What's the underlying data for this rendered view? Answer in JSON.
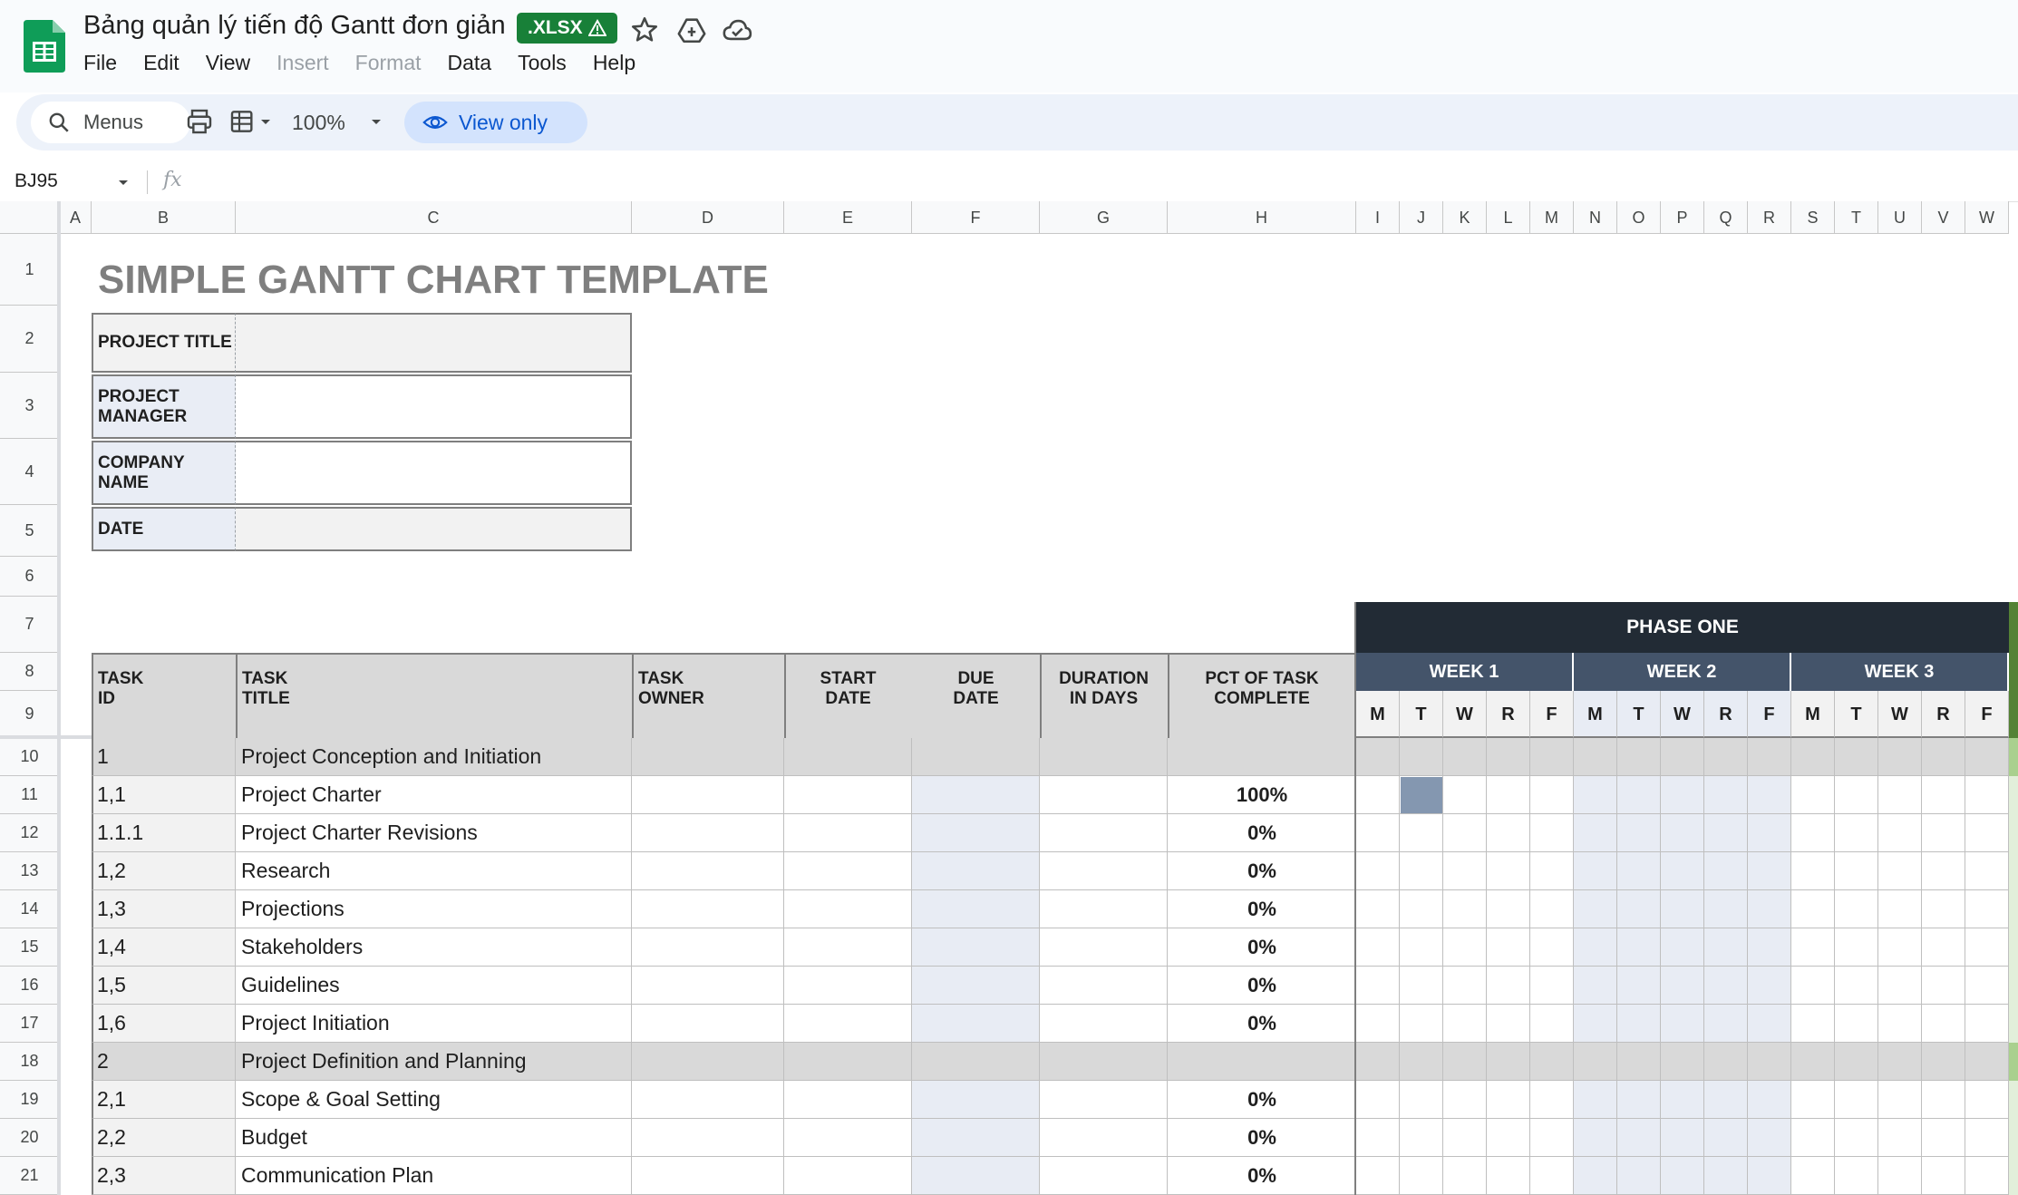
{
  "app": {
    "doc_title": "Bảng quản lý tiến độ Gantt đơn giản",
    "file_badge": ".XLSX",
    "brand_color": "#188038",
    "menu": [
      "File",
      "Edit",
      "View",
      "Insert",
      "Format",
      "Data",
      "Tools",
      "Help"
    ],
    "menu_disabled": [
      "Insert",
      "Format"
    ]
  },
  "toolbar": {
    "search_label": "Menus",
    "zoom": "100%",
    "view_only_label": "View only"
  },
  "formula_bar": {
    "cell_ref": "BJ95",
    "fx_label": "fx"
  },
  "columns": [
    "A",
    "B",
    "C",
    "D",
    "E",
    "F",
    "G",
    "H",
    "I",
    "J",
    "K",
    "L",
    "M",
    "N",
    "O",
    "P",
    "Q",
    "R",
    "S",
    "T",
    "U",
    "V",
    "W"
  ],
  "rows": [
    "1",
    "2",
    "3",
    "4",
    "5",
    "6",
    "7",
    "8",
    "9",
    "10",
    "11",
    "12",
    "13",
    "14",
    "15",
    "16",
    "17",
    "18",
    "19",
    "20",
    "21"
  ],
  "sheet": {
    "title": "SIMPLE GANTT CHART TEMPLATE",
    "info_labels": {
      "project_title": "PROJECT TITLE",
      "project_manager_1": "PROJECT",
      "project_manager_2": "MANAGER",
      "company_name_1": "COMPANY",
      "company_name_2": "NAME",
      "date": "DATE"
    },
    "headers": {
      "task_id_1": "TASK",
      "task_id_2": "ID",
      "task_title_1": "TASK",
      "task_title_2": "TITLE",
      "task_owner_1": "TASK",
      "task_owner_2": "OWNER",
      "start_1": "START",
      "start_2": "DATE",
      "due_1": "DUE",
      "due_2": "DATE",
      "duration_1": "DURATION",
      "duration_2": "IN DAYS",
      "pct_1": "PCT OF TASK",
      "pct_2": "COMPLETE"
    },
    "phase": "PHASE ONE",
    "weeks": [
      "WEEK 1",
      "WEEK 2",
      "WEEK 3"
    ],
    "days": [
      "M",
      "T",
      "W",
      "R",
      "F",
      "M",
      "T",
      "W",
      "R",
      "F",
      "M",
      "T",
      "W",
      "R",
      "F"
    ],
    "tasks": [
      {
        "id": "1",
        "title": "Project Conception and Initiation",
        "pct": "",
        "group": true
      },
      {
        "id": "1,1",
        "title": "Project Charter",
        "pct": "100%",
        "group": false
      },
      {
        "id": "1.1.1",
        "title": "Project Charter Revisions",
        "pct": "0%",
        "group": false
      },
      {
        "id": "1,2",
        "title": "Research",
        "pct": "0%",
        "group": false
      },
      {
        "id": "1,3",
        "title": "Projections",
        "pct": "0%",
        "group": false
      },
      {
        "id": "1,4",
        "title": "Stakeholders",
        "pct": "0%",
        "group": false
      },
      {
        "id": "1,5",
        "title": "Guidelines",
        "pct": "0%",
        "group": false
      },
      {
        "id": "1,6",
        "title": "Project Initiation",
        "pct": "0%",
        "group": false
      },
      {
        "id": "2",
        "title": "Project Definition and Planning",
        "pct": "",
        "group": true
      },
      {
        "id": "2,1",
        "title": "Scope & Goal Setting",
        "pct": "0%",
        "group": false
      },
      {
        "id": "2,2",
        "title": "Budget",
        "pct": "0%",
        "group": false
      },
      {
        "id": "2,3",
        "title": "Communication Plan",
        "pct": "0%",
        "group": false
      }
    ],
    "colors": {
      "phase_bg": "#222b35",
      "week_bg": "#44546a",
      "group_row_bg": "#d9d9d9",
      "gantt_bar": "#8497b0",
      "week2_shade": "#e8ecf4"
    }
  }
}
